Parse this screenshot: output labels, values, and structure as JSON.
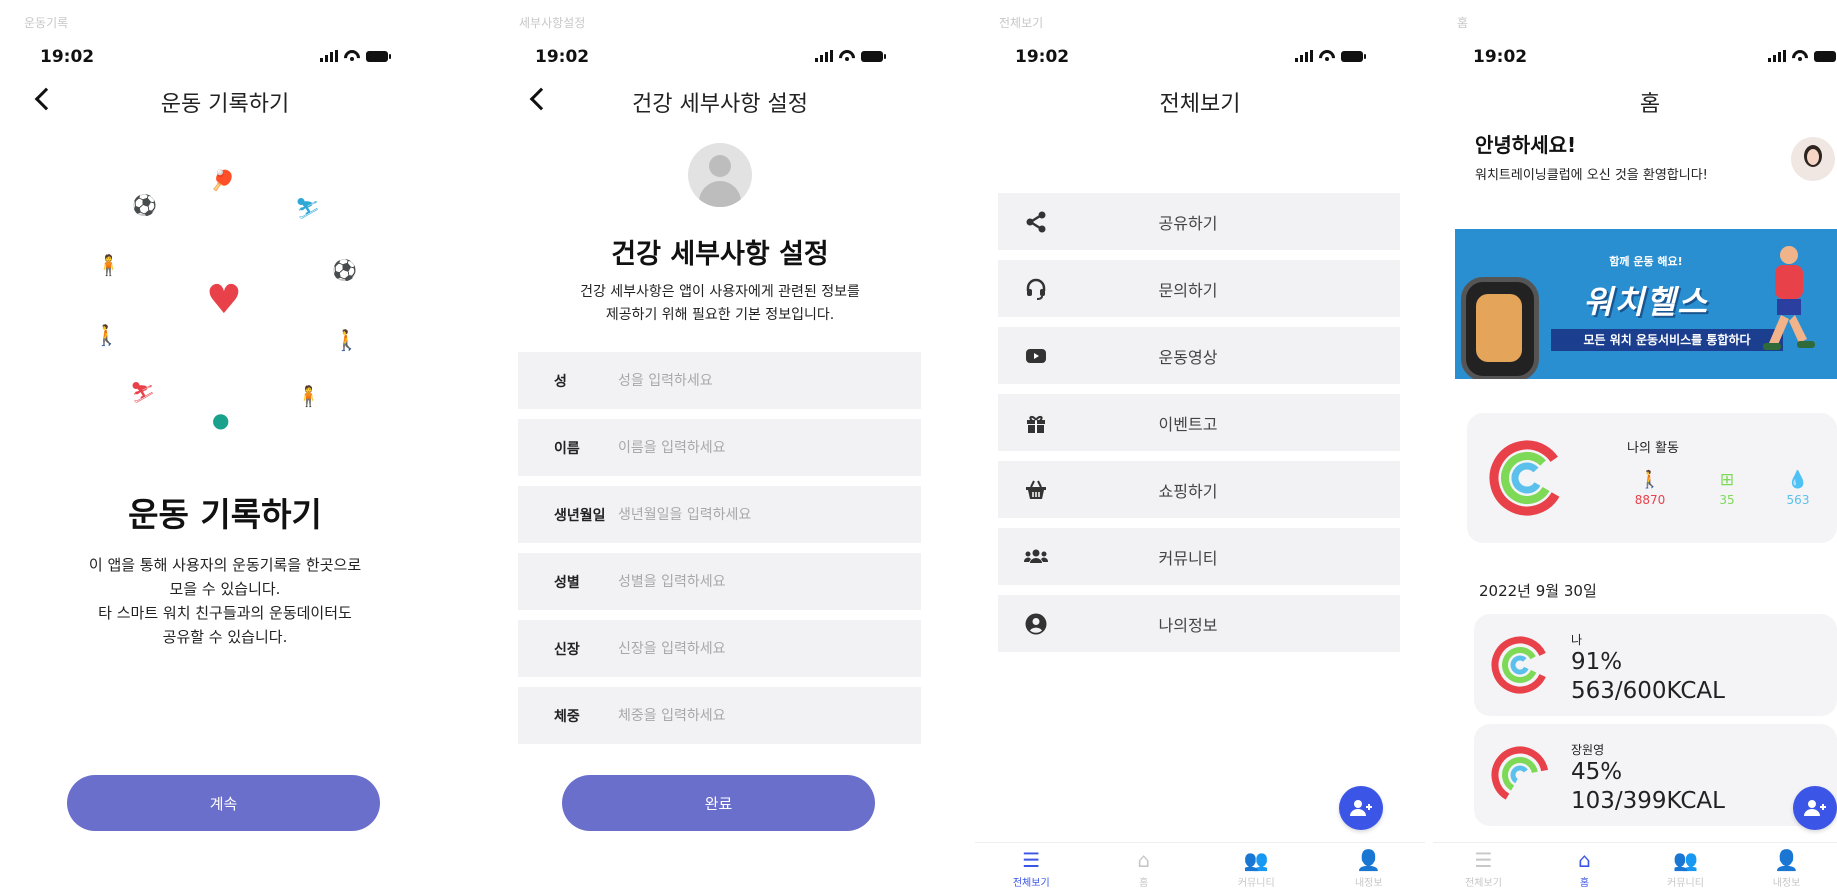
{
  "common": {
    "time": "19:02"
  },
  "screen1": {
    "frame_label": "운동기록",
    "nav_title": "운동 기록하기",
    "title": "운동 기록하기",
    "desc_lines": [
      "이 앱을 통해 사용자의 운동기록을 한곳으로",
      "모을 수 있습니다.",
      "타 스마트 워치 친구들과의 운동데이터도",
      "공유할 수 있습니다."
    ],
    "button": "계속",
    "accent": "#6b6fcc"
  },
  "screen2": {
    "frame_label": "세부사항설정",
    "nav_title": "건강 세부사항 설정",
    "title": "건강 세부사항 설정",
    "desc_lines": [
      "건강 세부사항은 앱이 사용자에게 관련된 정보를",
      "제공하기 위해 필요한 기본 정보입니다."
    ],
    "fields": [
      {
        "label": "성",
        "placeholder": "성을 입력하세요",
        "value": ""
      },
      {
        "label": "이름",
        "placeholder": "이름을 입력하세요",
        "value": ""
      },
      {
        "label": "생년월일",
        "placeholder": "생년월일을 입력하세요",
        "value": ""
      },
      {
        "label": "성별",
        "placeholder": "성별을 입력하세요",
        "value": ""
      },
      {
        "label": "신장",
        "placeholder": "신장을 입력하세요",
        "value": ""
      },
      {
        "label": "체중",
        "placeholder": "체중을 입력하세요",
        "value": ""
      }
    ],
    "button": "완료"
  },
  "screen3": {
    "frame_label": "전체보기",
    "nav_title": "전체보기",
    "menu": [
      {
        "label": "공유하기",
        "icon": "share-icon"
      },
      {
        "label": "문의하기",
        "icon": "headset-icon"
      },
      {
        "label": "운동영상",
        "icon": "video-icon"
      },
      {
        "label": "이벤트고",
        "icon": "gift-icon"
      },
      {
        "label": "쇼핑하기",
        "icon": "basket-icon"
      },
      {
        "label": "커뮤니티",
        "icon": "users-icon"
      },
      {
        "label": "나의정보",
        "icon": "user-circle-icon"
      }
    ],
    "tabs": [
      "전체보기",
      "홈",
      "커뮤니티",
      "내정보"
    ],
    "active_tab": 0
  },
  "screen4": {
    "frame_label": "홈",
    "nav_title": "홈",
    "greeting": "안녕하세요!",
    "welcome": "워치트레이닝클럽에 오신 것을 환영합니다!",
    "banner": {
      "small": "함께 운동 해요!",
      "title": "워치헬스",
      "strip": "모든 워치 운동서비스를 통합하다"
    },
    "activity": {
      "title": "나의 활동",
      "steps": "8870",
      "workout": "35",
      "water": "563",
      "colors": {
        "steps": "#e8414a",
        "workout": "#7ed957",
        "water": "#5bc0eb"
      }
    },
    "date": "2022년 9월 30일",
    "friends": [
      {
        "name": "나",
        "percent": "91%",
        "kcal": "563/600KCAL"
      },
      {
        "name": "장원영",
        "percent": "45%",
        "kcal": "103/399KCAL"
      }
    ],
    "tabs": [
      "전체보기",
      "홈",
      "커뮤니티",
      "내정보"
    ],
    "active_tab": 1
  }
}
